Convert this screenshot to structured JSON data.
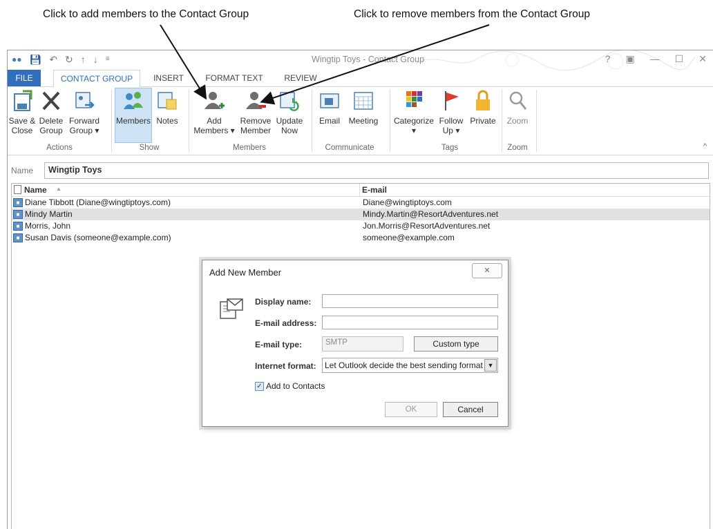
{
  "callouts": {
    "add": "Click to add members to the Contact Group",
    "remove": "Click to remove members from the Contact Group"
  },
  "window": {
    "title": "Wingtip Toys - Contact Group",
    "controls": [
      "?",
      "▣",
      "—",
      "☐",
      "✕"
    ]
  },
  "tabs": [
    "FILE",
    "CONTACT GROUP",
    "INSERT",
    "FORMAT TEXT",
    "REVIEW"
  ],
  "ribbon": {
    "save_close": [
      "Save &",
      "Close"
    ],
    "delete_group": [
      "Delete",
      "Group"
    ],
    "forward_group": [
      "Forward",
      "Group ▾"
    ],
    "members": "Members",
    "notes": "Notes",
    "add_members": [
      "Add",
      "Members ▾"
    ],
    "remove_member": [
      "Remove",
      "Member"
    ],
    "update_now": [
      "Update",
      "Now"
    ],
    "email": "Email",
    "meeting": "Meeting",
    "categorize": [
      "Categorize",
      "▾"
    ],
    "follow_up": [
      "Follow",
      "Up ▾"
    ],
    "private": "Private",
    "zoom": "Zoom",
    "groups": {
      "actions": "Actions",
      "show": "Show",
      "members": "Members",
      "communicate": "Communicate",
      "tags": "Tags",
      "zoom": "Zoom"
    },
    "collapse": "^"
  },
  "name_field": {
    "label": "Name",
    "value": "Wingtip Toys"
  },
  "list": {
    "headers": {
      "name": "Name",
      "email": "E-mail",
      "sort": "▲"
    },
    "rows": [
      {
        "name": "Diane Tibbott (Diane@wingtiptoys.com)",
        "email": "Diane@wingtiptoys.com"
      },
      {
        "name": "Mindy Martin",
        "email": "Mindy.Martin@ResortAdventures.net"
      },
      {
        "name": "Morris, John",
        "email": "Jon.Morris@ResortAdventures.net"
      },
      {
        "name": "Susan Davis (someone@example.com)",
        "email": "someone@example.com"
      }
    ]
  },
  "dialog": {
    "title": "Add New Member",
    "close": "✕",
    "display_name_label": "Display name:",
    "display_name_value": "",
    "email_label": "E-mail address:",
    "email_value": "",
    "type_label": "E-mail type:",
    "type_value": "SMTP",
    "custom_type": "Custom type",
    "format_label": "Internet format:",
    "format_value": "Let Outlook decide the best sending format",
    "add_to_contacts": "Add to Contacts",
    "add_to_contacts_checked": true,
    "ok": "OK",
    "cancel": "Cancel"
  }
}
